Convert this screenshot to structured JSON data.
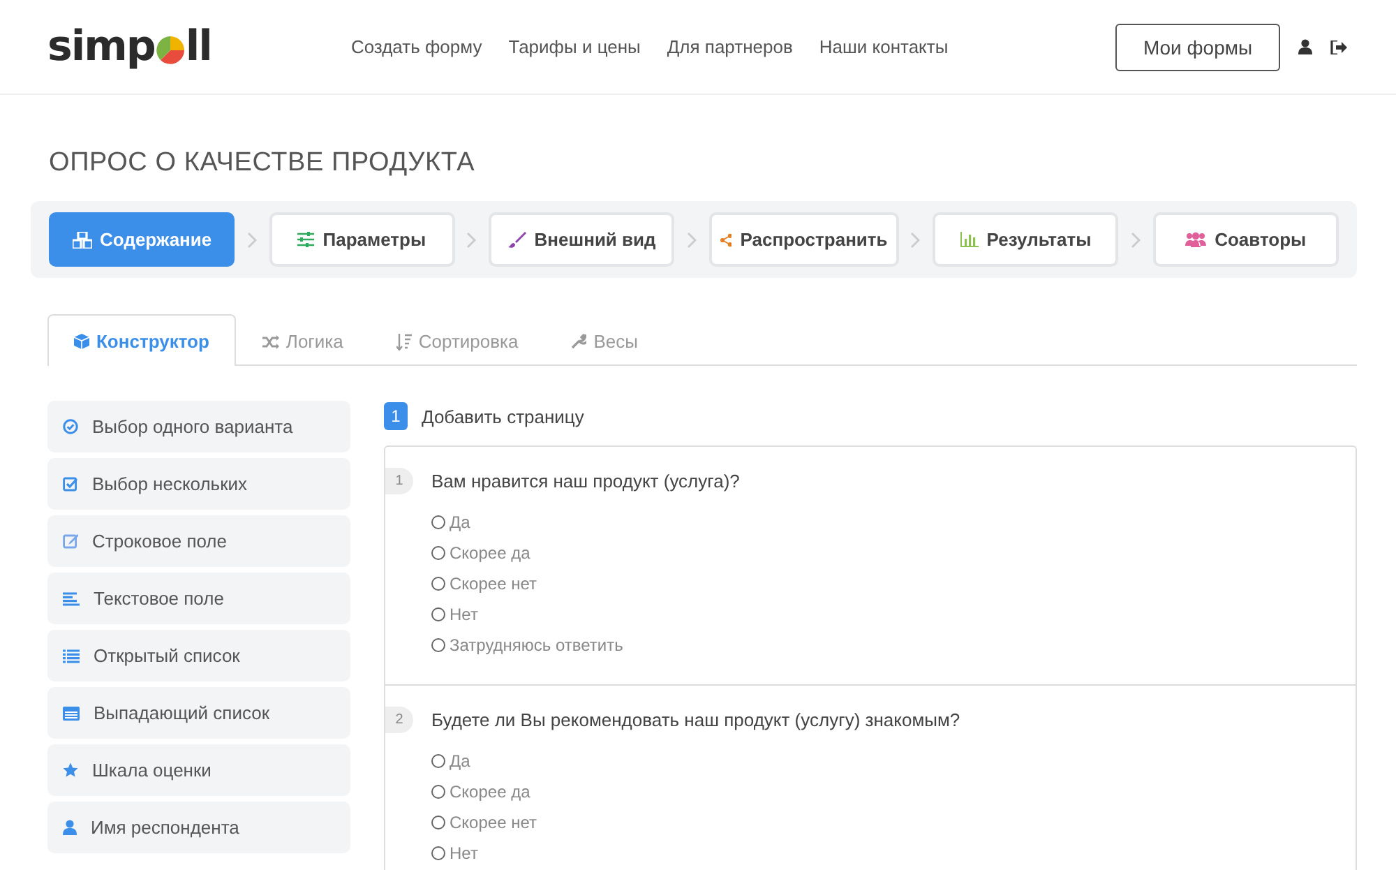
{
  "header": {
    "logo": {
      "before": "simp",
      "after": "ll"
    },
    "nav": [
      "Создать форму",
      "Тарифы и цены",
      "Для партнеров",
      "Наши контакты"
    ],
    "my_forms_button": "Мои формы"
  },
  "survey_title": "ОПРОС О КАЧЕСТВЕ ПРОДУКТА",
  "steps": [
    {
      "label": "Содержание",
      "selected": true,
      "color": "#ffffff"
    },
    {
      "label": "Параметры",
      "selected": false,
      "color": "#2eaa5c"
    },
    {
      "label": "Внешний вид",
      "selected": false,
      "color": "#8e44ad"
    },
    {
      "label": "Распространить",
      "selected": false,
      "color": "#e67e22"
    },
    {
      "label": "Результаты",
      "selected": false,
      "color": "#8cc152"
    },
    {
      "label": "Соавторы",
      "selected": false,
      "color": "#e0619a"
    }
  ],
  "tabs": [
    {
      "label": "Конструктор",
      "selected": true
    },
    {
      "label": "Логика",
      "selected": false
    },
    {
      "label": "Сортировка",
      "selected": false
    },
    {
      "label": "Весы",
      "selected": false
    }
  ],
  "toolbox": [
    "Выбор одного варианта",
    "Выбор нескольких",
    "Строковое поле",
    "Текстовое поле",
    "Открытый список",
    "Выпадающий список",
    "Шкала оценки",
    "Имя респондента"
  ],
  "page": {
    "number": "1",
    "label": "Добавить страницу"
  },
  "questions": [
    {
      "number": "1",
      "text": "Вам нравится наш продукт (услуга)?",
      "options": [
        {
          "label": "Да",
          "selected": false
        },
        {
          "label": "Скорее да",
          "selected": false
        },
        {
          "label": "Скорее нет",
          "selected": false
        },
        {
          "label": "Нет",
          "selected": false
        },
        {
          "label": "Затрудняюсь ответить",
          "selected": false
        }
      ]
    },
    {
      "number": "2",
      "text": "Будете ли Вы рекомендовать наш продукт (услугу) знакомым?",
      "options": [
        {
          "label": "Да",
          "selected": false
        },
        {
          "label": "Скорее да",
          "selected": false
        },
        {
          "label": "Скорее нет",
          "selected": false
        },
        {
          "label": "Нет",
          "selected": false
        }
      ]
    }
  ]
}
